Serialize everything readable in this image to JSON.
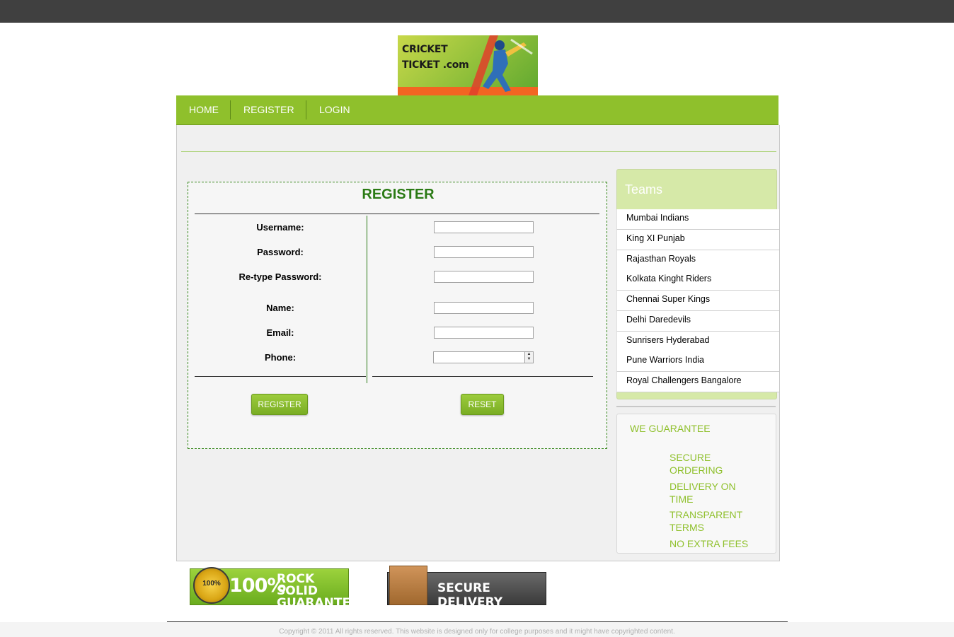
{
  "logo": {
    "line1": "CRICKET",
    "line2": "TICKET .com"
  },
  "nav": {
    "home": "HOME",
    "register": "REGISTER",
    "login": "LOGIN"
  },
  "form": {
    "title": "REGISTER",
    "fields": {
      "username": "Username:",
      "password": "Password:",
      "retype": "Re-type Password:",
      "name": "Name:",
      "email": "Email:",
      "phone": "Phone:"
    },
    "register_button": "REGISTER",
    "reset_button": "RESET"
  },
  "teams": {
    "title": "Teams",
    "items": [
      "Mumbai Indians",
      "King XI Punjab",
      "Rajasthan Royals",
      "Kolkata Kinght Riders",
      "Chennai Super Kings",
      "Delhi Daredevils",
      "Sunrisers Hyderabad",
      "Pune Warriors India",
      "Royal Challengers Bangalore"
    ]
  },
  "guarantee": {
    "title": "WE GUARANTEE",
    "items": [
      "SECURE ORDERING",
      "DELIVERY ON TIME",
      "TRANSPARENT TERMS",
      "NO EXTRA FEES"
    ]
  },
  "badges": {
    "seal": "100%",
    "rock_big": "100%",
    "rock_line1": "ROCK SOLID",
    "rock_line2": "GUARANTEE",
    "delivery": "SECURE DELIVERY"
  },
  "footer": {
    "text": "Copyright © 2011 All rights reserved. This website is designed only for college purposes and it might have copyrighted content."
  }
}
